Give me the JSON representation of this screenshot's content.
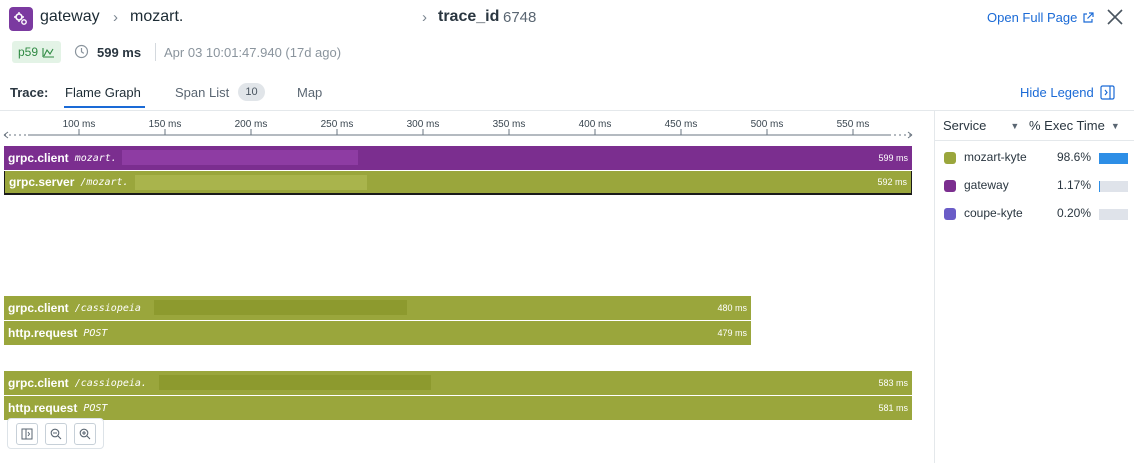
{
  "header": {
    "service": "gateway",
    "resource": "mozart.",
    "trace_label": "trace_id",
    "trace_id": "6748",
    "open_full_page": "Open Full Page"
  },
  "meta": {
    "percentile": "p59",
    "duration": "599 ms",
    "timestamp": "Apr 03 10:01:47.940 (17d ago)"
  },
  "tabs": {
    "label": "Trace:",
    "items": [
      {
        "label": "Flame Graph",
        "active": true
      },
      {
        "label": "Span List",
        "count": "10",
        "active": false
      },
      {
        "label": "Map",
        "active": false
      }
    ],
    "hide_legend": "Hide Legend"
  },
  "timeline": {
    "ticks": [
      "100 ms",
      "150 ms",
      "200 ms",
      "250 ms",
      "300 ms",
      "350 ms",
      "400 ms",
      "450 ms",
      "500 ms",
      "550 ms"
    ]
  },
  "spans": [
    {
      "name": "grpc.client",
      "resource": "mozart.",
      "duration": "599 ms",
      "service": "gateway"
    },
    {
      "name": "grpc.server",
      "resource": "/mozart.",
      "duration": "592 ms",
      "service": "mozart-kyte"
    },
    {
      "name": "grpc.client",
      "resource": "/cassiopeia",
      "duration": "480 ms",
      "service": "mozart-kyte"
    },
    {
      "name": "http.request",
      "resource": "POST",
      "duration": "479 ms",
      "service": "mozart-kyte"
    },
    {
      "name": "grpc.client",
      "resource": "/cassiopeia.",
      "duration": "583 ms",
      "service": "mozart-kyte"
    },
    {
      "name": "http.request",
      "resource": "POST",
      "duration": "581 ms",
      "service": "mozart-kyte"
    }
  ],
  "legend": {
    "col_service": "Service",
    "col_exec": "% Exec Time",
    "rows": [
      {
        "service": "mozart-kyte",
        "pct": "98.6%",
        "fraction": 0.986,
        "color": "#9aa63c"
      },
      {
        "service": "gateway",
        "pct": "1.17%",
        "fraction": 0.0117,
        "color": "#7b2e8f"
      },
      {
        "service": "coupe-kyte",
        "pct": "0.20%",
        "fraction": 0.002,
        "color": "#6a5cc7"
      }
    ]
  },
  "colors": {
    "gateway": "#7b2e8f",
    "mozart_kyte": "#9aa63c",
    "accent": "#1a6ad6"
  }
}
